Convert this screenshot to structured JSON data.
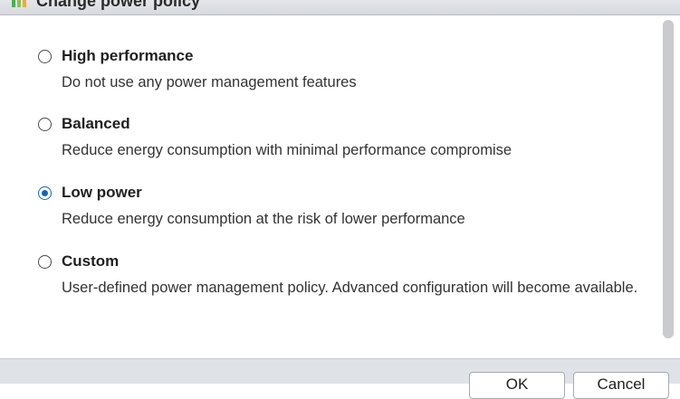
{
  "dialog": {
    "title": "Change power policy",
    "title_icon": "power-policy-icon"
  },
  "options": [
    {
      "label": "High performance",
      "description": "Do not use any power management features",
      "selected": false
    },
    {
      "label": "Balanced",
      "description": "Reduce energy consumption with minimal performance compromise",
      "selected": false
    },
    {
      "label": "Low power",
      "description": "Reduce energy consumption at the risk of lower performance",
      "selected": true
    },
    {
      "label": "Custom",
      "description": "User-defined power management policy. Advanced configuration will become available.",
      "selected": false
    }
  ],
  "footer": {
    "ok_label": "OK",
    "cancel_label": "Cancel"
  },
  "colors": {
    "accent": "#1565c0",
    "footer_bg": "#dfe3e8"
  }
}
